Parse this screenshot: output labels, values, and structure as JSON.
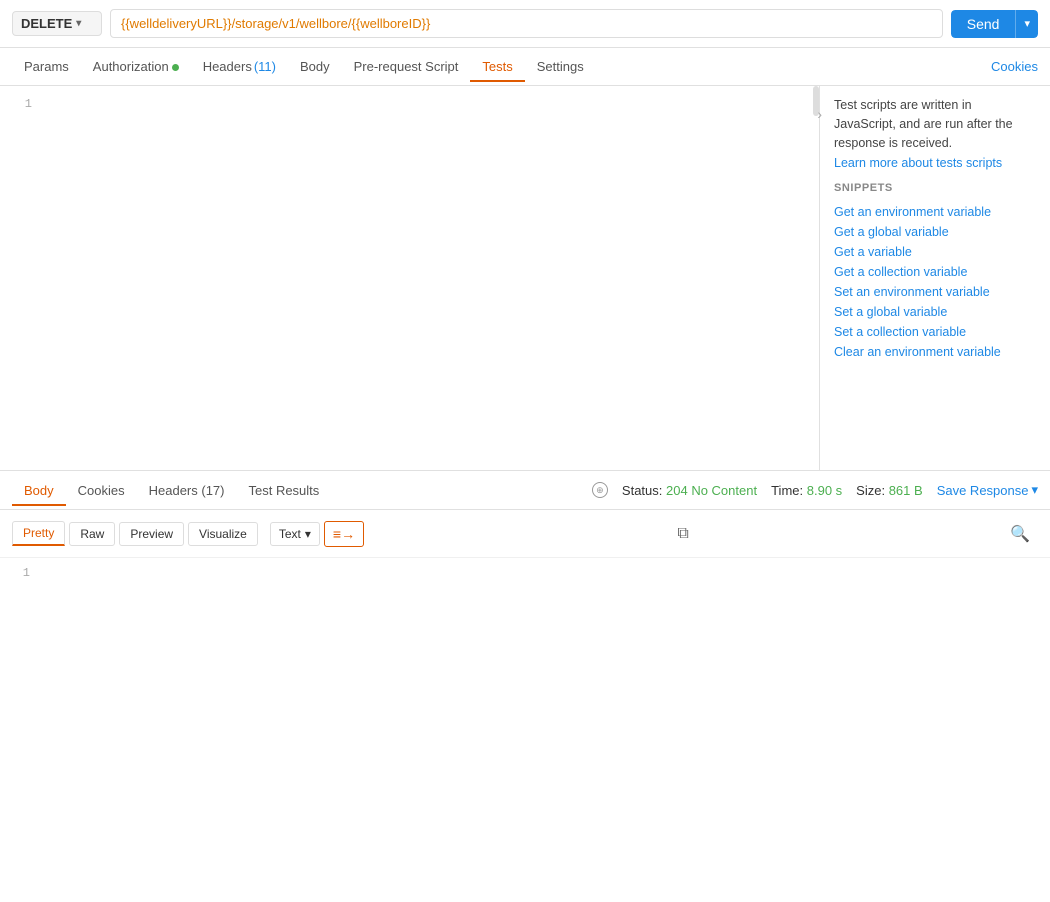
{
  "method": {
    "label": "DELETE",
    "chevron": "▾"
  },
  "url": "{{welldeliveryURL}}/storage/v1/wellbore/{{wellboreID}}",
  "send_button": {
    "label": "Send",
    "arrow": "▾"
  },
  "tabs": [
    {
      "id": "params",
      "label": "Params",
      "active": false,
      "dot": false,
      "count": null
    },
    {
      "id": "authorization",
      "label": "Authorization",
      "active": false,
      "dot": true,
      "count": null
    },
    {
      "id": "headers",
      "label": "Headers",
      "active": false,
      "dot": false,
      "count": "(11)"
    },
    {
      "id": "body",
      "label": "Body",
      "active": false,
      "dot": false,
      "count": null
    },
    {
      "id": "pre-request",
      "label": "Pre-request Script",
      "active": false,
      "dot": false,
      "count": null
    },
    {
      "id": "tests",
      "label": "Tests",
      "active": true,
      "dot": false,
      "count": null
    },
    {
      "id": "settings",
      "label": "Settings",
      "active": false,
      "dot": false,
      "count": null
    }
  ],
  "cookies_label": "Cookies",
  "editor": {
    "line_number": "1"
  },
  "snippets": {
    "description": "Test scripts are written in JavaScript, and are run after the response is received.",
    "learn_link": "Learn more about tests scripts",
    "section_label": "SNIPPETS",
    "items": [
      "Get an environment variable",
      "Get a global variable",
      "Get a variable",
      "Get a collection variable",
      "Set an environment variable",
      "Set a global variable",
      "Set a collection variable",
      "Clear an environment variable"
    ]
  },
  "response": {
    "tabs": [
      "Body",
      "Cookies",
      "Headers (17)",
      "Test Results"
    ],
    "active_tab": "Body",
    "status_label": "Status:",
    "status_value": "204 No Content",
    "time_label": "Time:",
    "time_value": "8.90 s",
    "size_label": "Size:",
    "size_value": "861 B",
    "save_response": "Save Response",
    "format_buttons": [
      "Pretty",
      "Raw",
      "Preview",
      "Visualize"
    ],
    "active_format": "Pretty",
    "text_dropdown_label": "Text",
    "line_number": "1"
  },
  "colors": {
    "accent": "#e05a00",
    "blue": "#1e88e5",
    "green": "#4caf50"
  }
}
